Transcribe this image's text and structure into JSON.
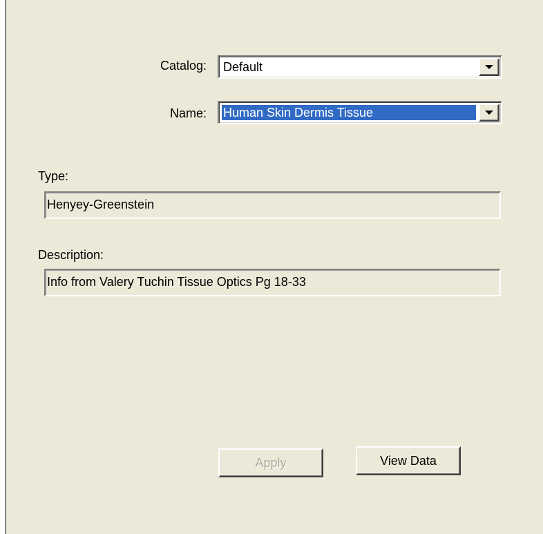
{
  "form": {
    "catalog": {
      "label": "Catalog:",
      "value": "Default"
    },
    "name": {
      "label": "Name:",
      "value": "Human Skin Dermis Tissue",
      "selected": true
    },
    "type": {
      "label": "Type:",
      "value": "Henyey-Greenstein"
    },
    "description": {
      "label": "Description:",
      "value": "Info from Valery Tuchin Tissue Optics Pg 18-33"
    }
  },
  "buttons": {
    "apply": {
      "label": "Apply",
      "enabled": false
    },
    "view_data": {
      "label": "View Data",
      "enabled": true
    }
  },
  "icons": {
    "dropdown": "chevron-down-icon"
  },
  "colors": {
    "panel_background": "#ece9d8",
    "selection_highlight": "#316ac5",
    "disabled_text": "#aca899"
  }
}
